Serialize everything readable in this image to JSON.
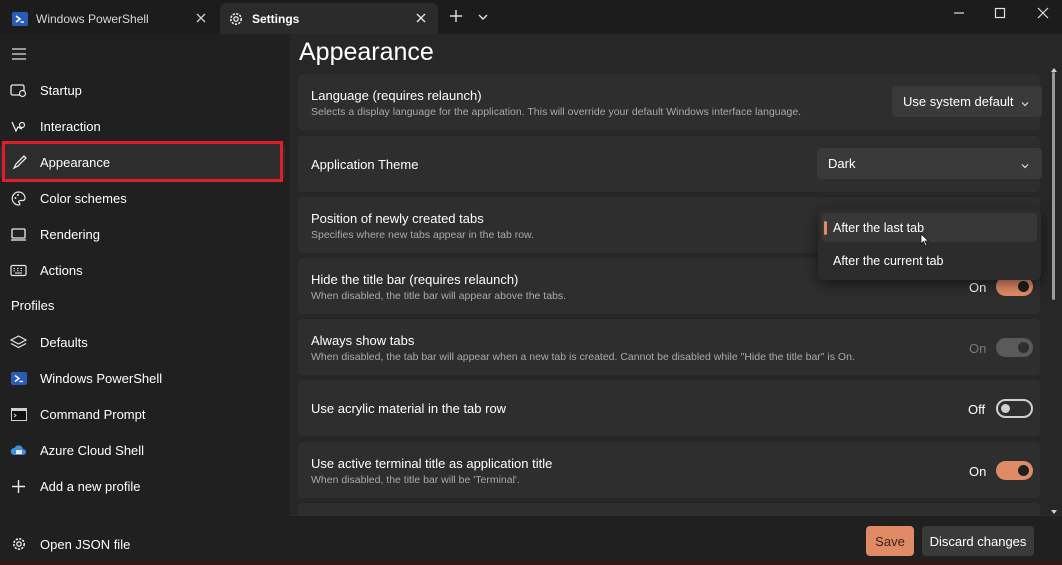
{
  "tabs": [
    {
      "title": "Windows PowerShell",
      "icon": "powershell-icon"
    },
    {
      "title": "Settings",
      "icon": "gear-icon",
      "active": true
    }
  ],
  "sidebar": {
    "items": [
      {
        "label": "Startup",
        "icon": "startup-icon"
      },
      {
        "label": "Interaction",
        "icon": "interaction-icon"
      },
      {
        "label": "Appearance",
        "icon": "paintbrush-icon",
        "selected": true
      },
      {
        "label": "Color schemes",
        "icon": "palette-icon"
      },
      {
        "label": "Rendering",
        "icon": "monitor-icon"
      },
      {
        "label": "Actions",
        "icon": "keyboard-icon"
      }
    ],
    "profiles_header": "Profiles",
    "profiles": [
      {
        "label": "Defaults",
        "icon": "layers-icon"
      },
      {
        "label": "Windows PowerShell",
        "icon": "powershell-icon"
      },
      {
        "label": "Command Prompt",
        "icon": "cmd-icon"
      },
      {
        "label": "Azure Cloud Shell",
        "icon": "azure-icon"
      },
      {
        "label": "Add a new profile",
        "icon": "plus-icon"
      }
    ],
    "open_json": {
      "label": "Open JSON file",
      "icon": "gear-icon"
    }
  },
  "main": {
    "title": "Appearance",
    "settings": {
      "language": {
        "title": "Language (requires relaunch)",
        "desc": "Selects a display language for the application. This will override your default Windows interface language.",
        "value": "Use system default"
      },
      "theme": {
        "title": "Application Theme",
        "value": "Dark"
      },
      "tab_position": {
        "title": "Position of newly created tabs",
        "desc": "Specifies where new tabs appear in the tab row."
      },
      "hide_title_bar": {
        "title": "Hide the title bar (requires relaunch)",
        "desc": "When disabled, the title bar will appear above the tabs.",
        "state": "On"
      },
      "always_show_tabs": {
        "title": "Always show tabs",
        "desc": "When disabled, the tab bar will appear when a new tab is created. Cannot be disabled while \"Hide the title bar\" is On.",
        "state": "On"
      },
      "acrylic": {
        "title": "Use acrylic material in the tab row",
        "state": "Off"
      },
      "active_title": {
        "title": "Use active terminal title as application title",
        "desc": "When disabled, the title bar will be 'Terminal'.",
        "state": "On"
      }
    },
    "popup": {
      "options": [
        "After the last tab",
        "After the current tab"
      ],
      "selected": "After the last tab"
    }
  },
  "footer": {
    "save": "Save",
    "discard": "Discard changes"
  },
  "colors": {
    "accent": "#e08a66",
    "highlight_outline": "#e01e2a",
    "background": "#202020",
    "card": "#2e2e2e"
  }
}
